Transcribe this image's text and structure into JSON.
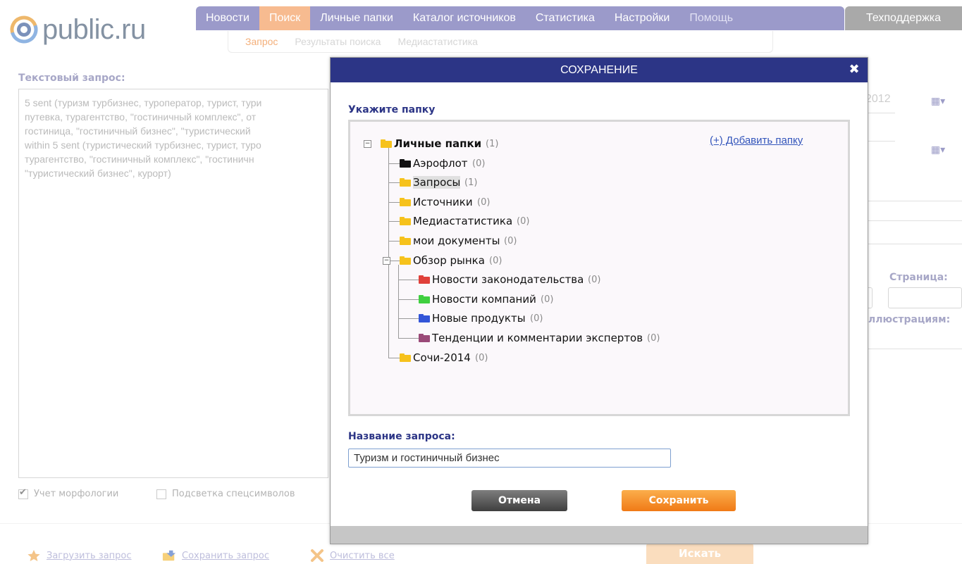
{
  "logo": {
    "text": "public.ru"
  },
  "nav": {
    "items": [
      {
        "label": "Новости"
      },
      {
        "label": "Поиск",
        "active": true
      },
      {
        "label": "Личные папки"
      },
      {
        "label": "Каталог источников"
      },
      {
        "label": "Статистика"
      },
      {
        "label": "Настройки"
      },
      {
        "label": "Помощь"
      }
    ],
    "support": "Техподдержка"
  },
  "subnav": {
    "items": [
      "Запрос",
      "Результаты поиска",
      "Медиастатистика"
    ],
    "active_index": 0
  },
  "query": {
    "title": "Текстовый запрос:",
    "text": "5 sent (туризм турбизнес, туроператор, турист, тури\nпутевка, турагентство, \"гостиничный комплекс\", от\nгостиница, \"гостиничный бизнес\", \"туристический\nwithin 5 sent (туристический турбизнес, турист, туро\nтурагентство, \"гостиничный комплекс\",  \"гостиничн\n\"туристический бизнес\", курорт)",
    "morphology_label": "Учет морфологии",
    "morphology_checked": true,
    "highlight_label": "Подсветка спецсимволов",
    "highlight_checked": false
  },
  "right_panel": {
    "date_text": "2012",
    "calendar_icon": "calendar-grid-icon",
    "page_label": "Страница:",
    "illustrations_label": "ллюстрациям:"
  },
  "actions": {
    "load": "Загрузить запрос",
    "save": "Сохранить запрос",
    "clear": "Очистить все",
    "search": "Искать"
  },
  "modal": {
    "title": "СОХРАНЕНИЕ",
    "close_icon": "close-icon",
    "folder_label": "Укажите папку",
    "add_folder": "(+) Добавить папку",
    "name_label": "Название запроса:",
    "name_value": "Туризм и гостиничный бизнес",
    "cancel": "Отмена",
    "save": "Сохранить"
  },
  "tree": [
    {
      "label": "Личные папки",
      "count": "(1)",
      "depth": 0,
      "color": "#f6c21c",
      "root": true,
      "expanded": true
    },
    {
      "label": "Аэрофлот",
      "count": "(0)",
      "depth": 1,
      "color": "#111111"
    },
    {
      "label": "Запросы",
      "count": "(1)",
      "depth": 1,
      "color": "#f6c21c",
      "selected": true
    },
    {
      "label": "Источники",
      "count": "(0)",
      "depth": 1,
      "color": "#f6c21c"
    },
    {
      "label": "Медиастатистика",
      "count": "(0)",
      "depth": 1,
      "color": "#f6c21c"
    },
    {
      "label": "мои документы",
      "count": "(0)",
      "depth": 1,
      "color": "#f6c21c"
    },
    {
      "label": "Обзор рынка",
      "count": "(0)",
      "depth": 1,
      "color": "#f6c21c",
      "expanded": true
    },
    {
      "label": "Новости законодательства",
      "count": "(0)",
      "depth": 2,
      "color": "#e0403a"
    },
    {
      "label": "Новости компаний",
      "count": "(0)",
      "depth": 2,
      "color": "#3fcf3f"
    },
    {
      "label": "Новые продукты",
      "count": "(0)",
      "depth": 2,
      "color": "#3355d8"
    },
    {
      "label": "Тенденции и комментарии экспертов",
      "count": "(0)",
      "depth": 2,
      "color": "#9a4a78"
    },
    {
      "label": "Сочи-2014",
      "count": "(0)",
      "depth": 1,
      "color": "#f6c21c"
    }
  ]
}
